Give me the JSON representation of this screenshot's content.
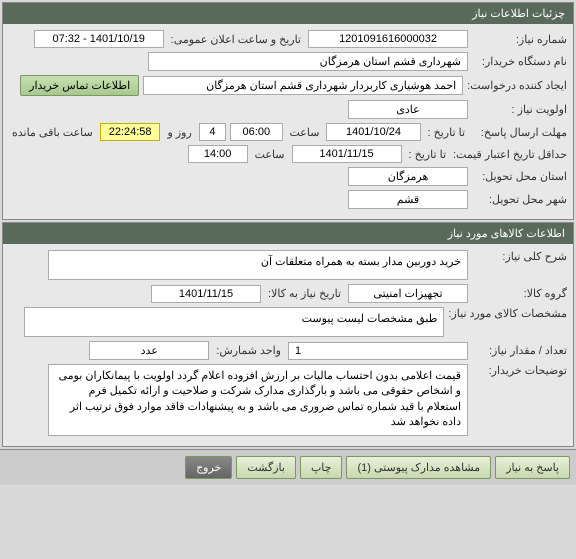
{
  "header1": "چزئیات اطلاعات نیاز",
  "section1": {
    "need_number_label": "شماره نیاز:",
    "need_number": "1201091616000032",
    "announce_label": "تاریخ و ساعت اعلان عمومی:",
    "announce_value": "1401/10/19 - 07:32",
    "buyer_label": "نام دستگاه خریدار:",
    "buyer_value": "شهرداری قشم استان هرمزگان",
    "requester_label": "ایجاد کننده درخواست:",
    "requester_value": "احمد هوشیاری کاربردار شهرداری قشم استان هرمزگان",
    "contact_btn": "اطلاعات تماس خریدار",
    "priority_label": "اولویت نیاز :",
    "priority_value": "عادی",
    "reply_deadline_label": "مهلت ارسال پاسخ:",
    "to_date_label": "تا تاریخ :",
    "reply_date": "1401/10/24",
    "time_label": "ساعت",
    "reply_time": "06:00",
    "days_value": "4",
    "days_label": "روز و",
    "remain_time": "22:24:58",
    "remain_label": "ساعت باقی مانده",
    "validity_label": "حداقل تاریخ اعتبار قیمت:",
    "validity_date": "1401/11/15",
    "validity_time": "14:00",
    "delivery_province_label": "استان محل تحویل:",
    "delivery_province": "هرمزگان",
    "delivery_city_label": "شهر محل تحویل:",
    "delivery_city": "قشم"
  },
  "header2": "اطلاعات کالاهای مورد نیاز",
  "section2": {
    "desc_label": "شرح کلی نیاز:",
    "desc_value": "خرید دوربین مدار بسته به همراه متعلقات آن",
    "group_label": "گروه کالا:",
    "group_value": "تجهیزات امنیتی",
    "need_date_label": "تاریخ نیاز به کالا:",
    "need_date": "1401/11/15",
    "specs_label": "مشخصات کالای مورد نیاز:",
    "specs_value": "طبق مشخصات لیست پیوست",
    "qty_label": "تعداد / مقدار نیاز:",
    "qty_value": "1",
    "unit_label": "واحد شمارش:",
    "unit_value": "عدد",
    "buyer_notes_label": "توضیحات خریدار:",
    "buyer_notes": "قیمت اعلامی بدون احتساب مالیات بر ارزش افزوده اعلام گردد اولویت با پیمانکاران بومی و اشخاص حقوقی می باشد و بارگذاری مدارک شرکت و صلاحیت و ارائه تکمیل فرم استعلام با قید شماره تماس ضروری می باشد و به پیشنهادات فاقد موارد فوق ترتیب اثر داده نخواهد شد"
  },
  "footer": {
    "reply": "پاسخ به نیاز",
    "attachments": "مشاهده مدارک پیوستی (1)",
    "print": "چاپ",
    "back": "بازگشت",
    "exit": "خروج"
  }
}
